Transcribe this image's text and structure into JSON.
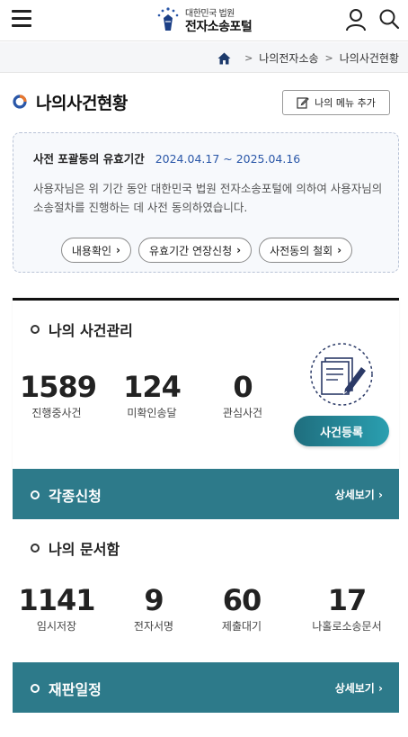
{
  "header": {
    "logo_sub": "대한민국 법원",
    "logo_main": "전자소송포털"
  },
  "breadcrumb": {
    "items": [
      "나의전자소송",
      "나의사건현황"
    ],
    "separator": ">"
  },
  "page": {
    "title": "나의사건현황",
    "menu_add_label": "나의 메뉴 추가"
  },
  "consent": {
    "label": "사전 포괄동의 유효기간",
    "dates": "2024.04.17 ~ 2025.04.16",
    "description": "사용자님은 위 기간 동안 대한민국 법원 전자소송포털에 의하여 사용자님의 소송절차를 진행하는 데 사전 동의하였습니다.",
    "buttons": [
      "내용확인",
      "유효기간 연장신청",
      "사전동의 철회"
    ]
  },
  "case_management": {
    "title": "나의 사건관리",
    "stats": [
      {
        "value": "1589",
        "label": "진행중사건"
      },
      {
        "value": "124",
        "label": "미확인송달"
      },
      {
        "value": "0",
        "label": "관심사건"
      }
    ],
    "register_label": "사건등록"
  },
  "applications": {
    "title": "각종신청",
    "detail_label": "상세보기"
  },
  "documents": {
    "title": "나의 문서함",
    "stats": [
      {
        "value": "1141",
        "label": "임시저장"
      },
      {
        "value": "9",
        "label": "전자서명"
      },
      {
        "value": "60",
        "label": "제출대기"
      },
      {
        "value": "17",
        "label": "나홀로소송문서"
      }
    ]
  },
  "schedule": {
    "title": "재판일정",
    "detail_label": "상세보기"
  },
  "colors": {
    "teal": "#2d7a8a",
    "accent_blue": "#2a57a8",
    "button_gradient_start": "#1f6e7e",
    "button_gradient_end": "#2a9fb0"
  }
}
